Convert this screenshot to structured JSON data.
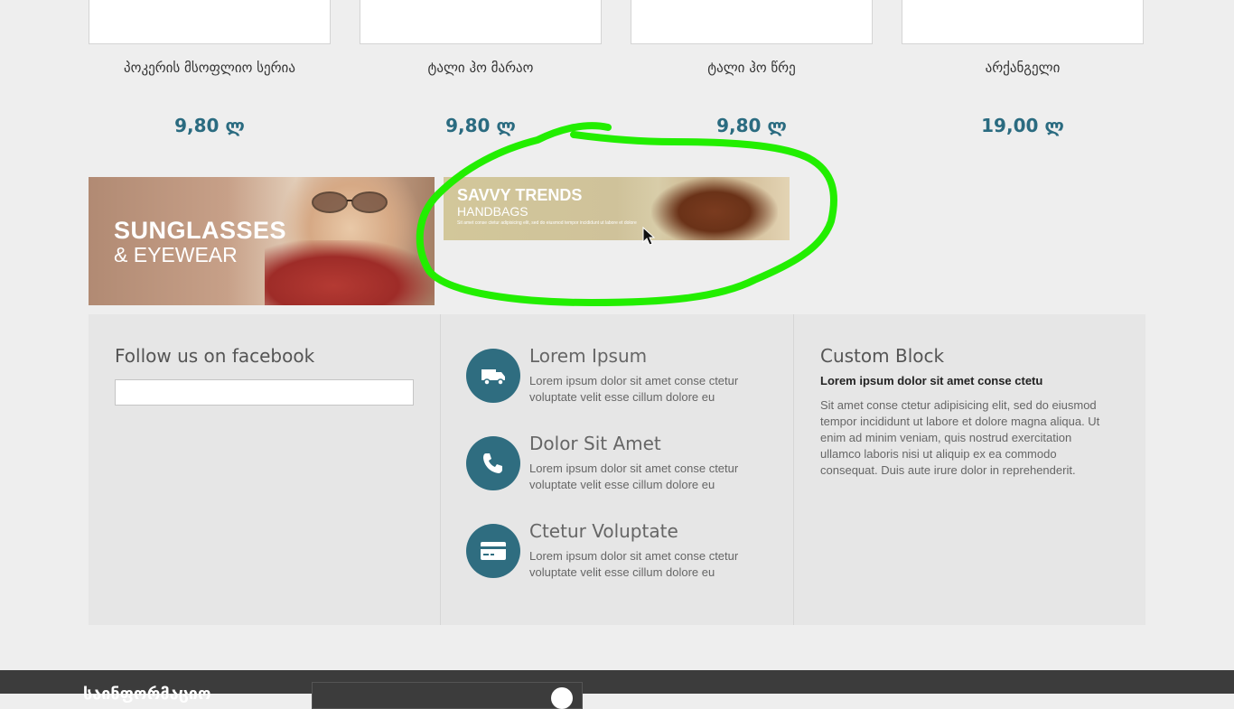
{
  "products": [
    {
      "name": "პოკერის მსოფლიო სერია",
      "price": "9,80 ლ"
    },
    {
      "name": "ტალი ჰო მარაო",
      "price": "9,80 ლ"
    },
    {
      "name": "ტალი ჰო წრე",
      "price": "9,80 ლ"
    },
    {
      "name": "არქანგელი",
      "price": "19,00 ლ"
    }
  ],
  "banners": {
    "sunglasses": {
      "title": "SUNGLASSES",
      "subtitle": "& EYEWEAR"
    },
    "handbags": {
      "title": "SAVVY TRENDS",
      "subtitle": "HANDBAGS",
      "desc": "Sit amet conse ctetur adipisicing elit, sed do eiusmod tempor incididunt ut labore et dolore"
    }
  },
  "facebook": {
    "title": "Follow us on facebook"
  },
  "features": [
    {
      "title": "Lorem Ipsum",
      "desc": "Lorem ipsum dolor sit amet conse ctetur voluptate velit esse cillum dolore eu",
      "icon": "truck-icon"
    },
    {
      "title": "Dolor Sit Amet",
      "desc": "Lorem ipsum dolor sit amet conse ctetur voluptate velit esse cillum dolore eu",
      "icon": "phone-icon"
    },
    {
      "title": "Ctetur Voluptate",
      "desc": "Lorem ipsum dolor sit amet conse ctetur voluptate velit esse cillum dolore eu",
      "icon": "credit-card-icon"
    }
  ],
  "custom_block": {
    "title": "Custom Block",
    "bold": "Lorem ipsum dolor sit amet conse ctetu",
    "text": "Sit amet conse ctetur adipisicing elit, sed do eiusmod tempor incididunt ut labore et dolore magna aliqua. Ut enim ad minim veniam, quis nostrud exercitation ullamco laboris nisi ut aliquip ex ea commodo consequat. Duis aute irure dolor in reprehenderit."
  },
  "footer": {
    "newsletter_label": "საინფორმაციო"
  },
  "colors": {
    "accent": "#2f6d80",
    "price": "#2a6b80",
    "annotation": "#22ee00",
    "footer": "#3c3c3c"
  }
}
